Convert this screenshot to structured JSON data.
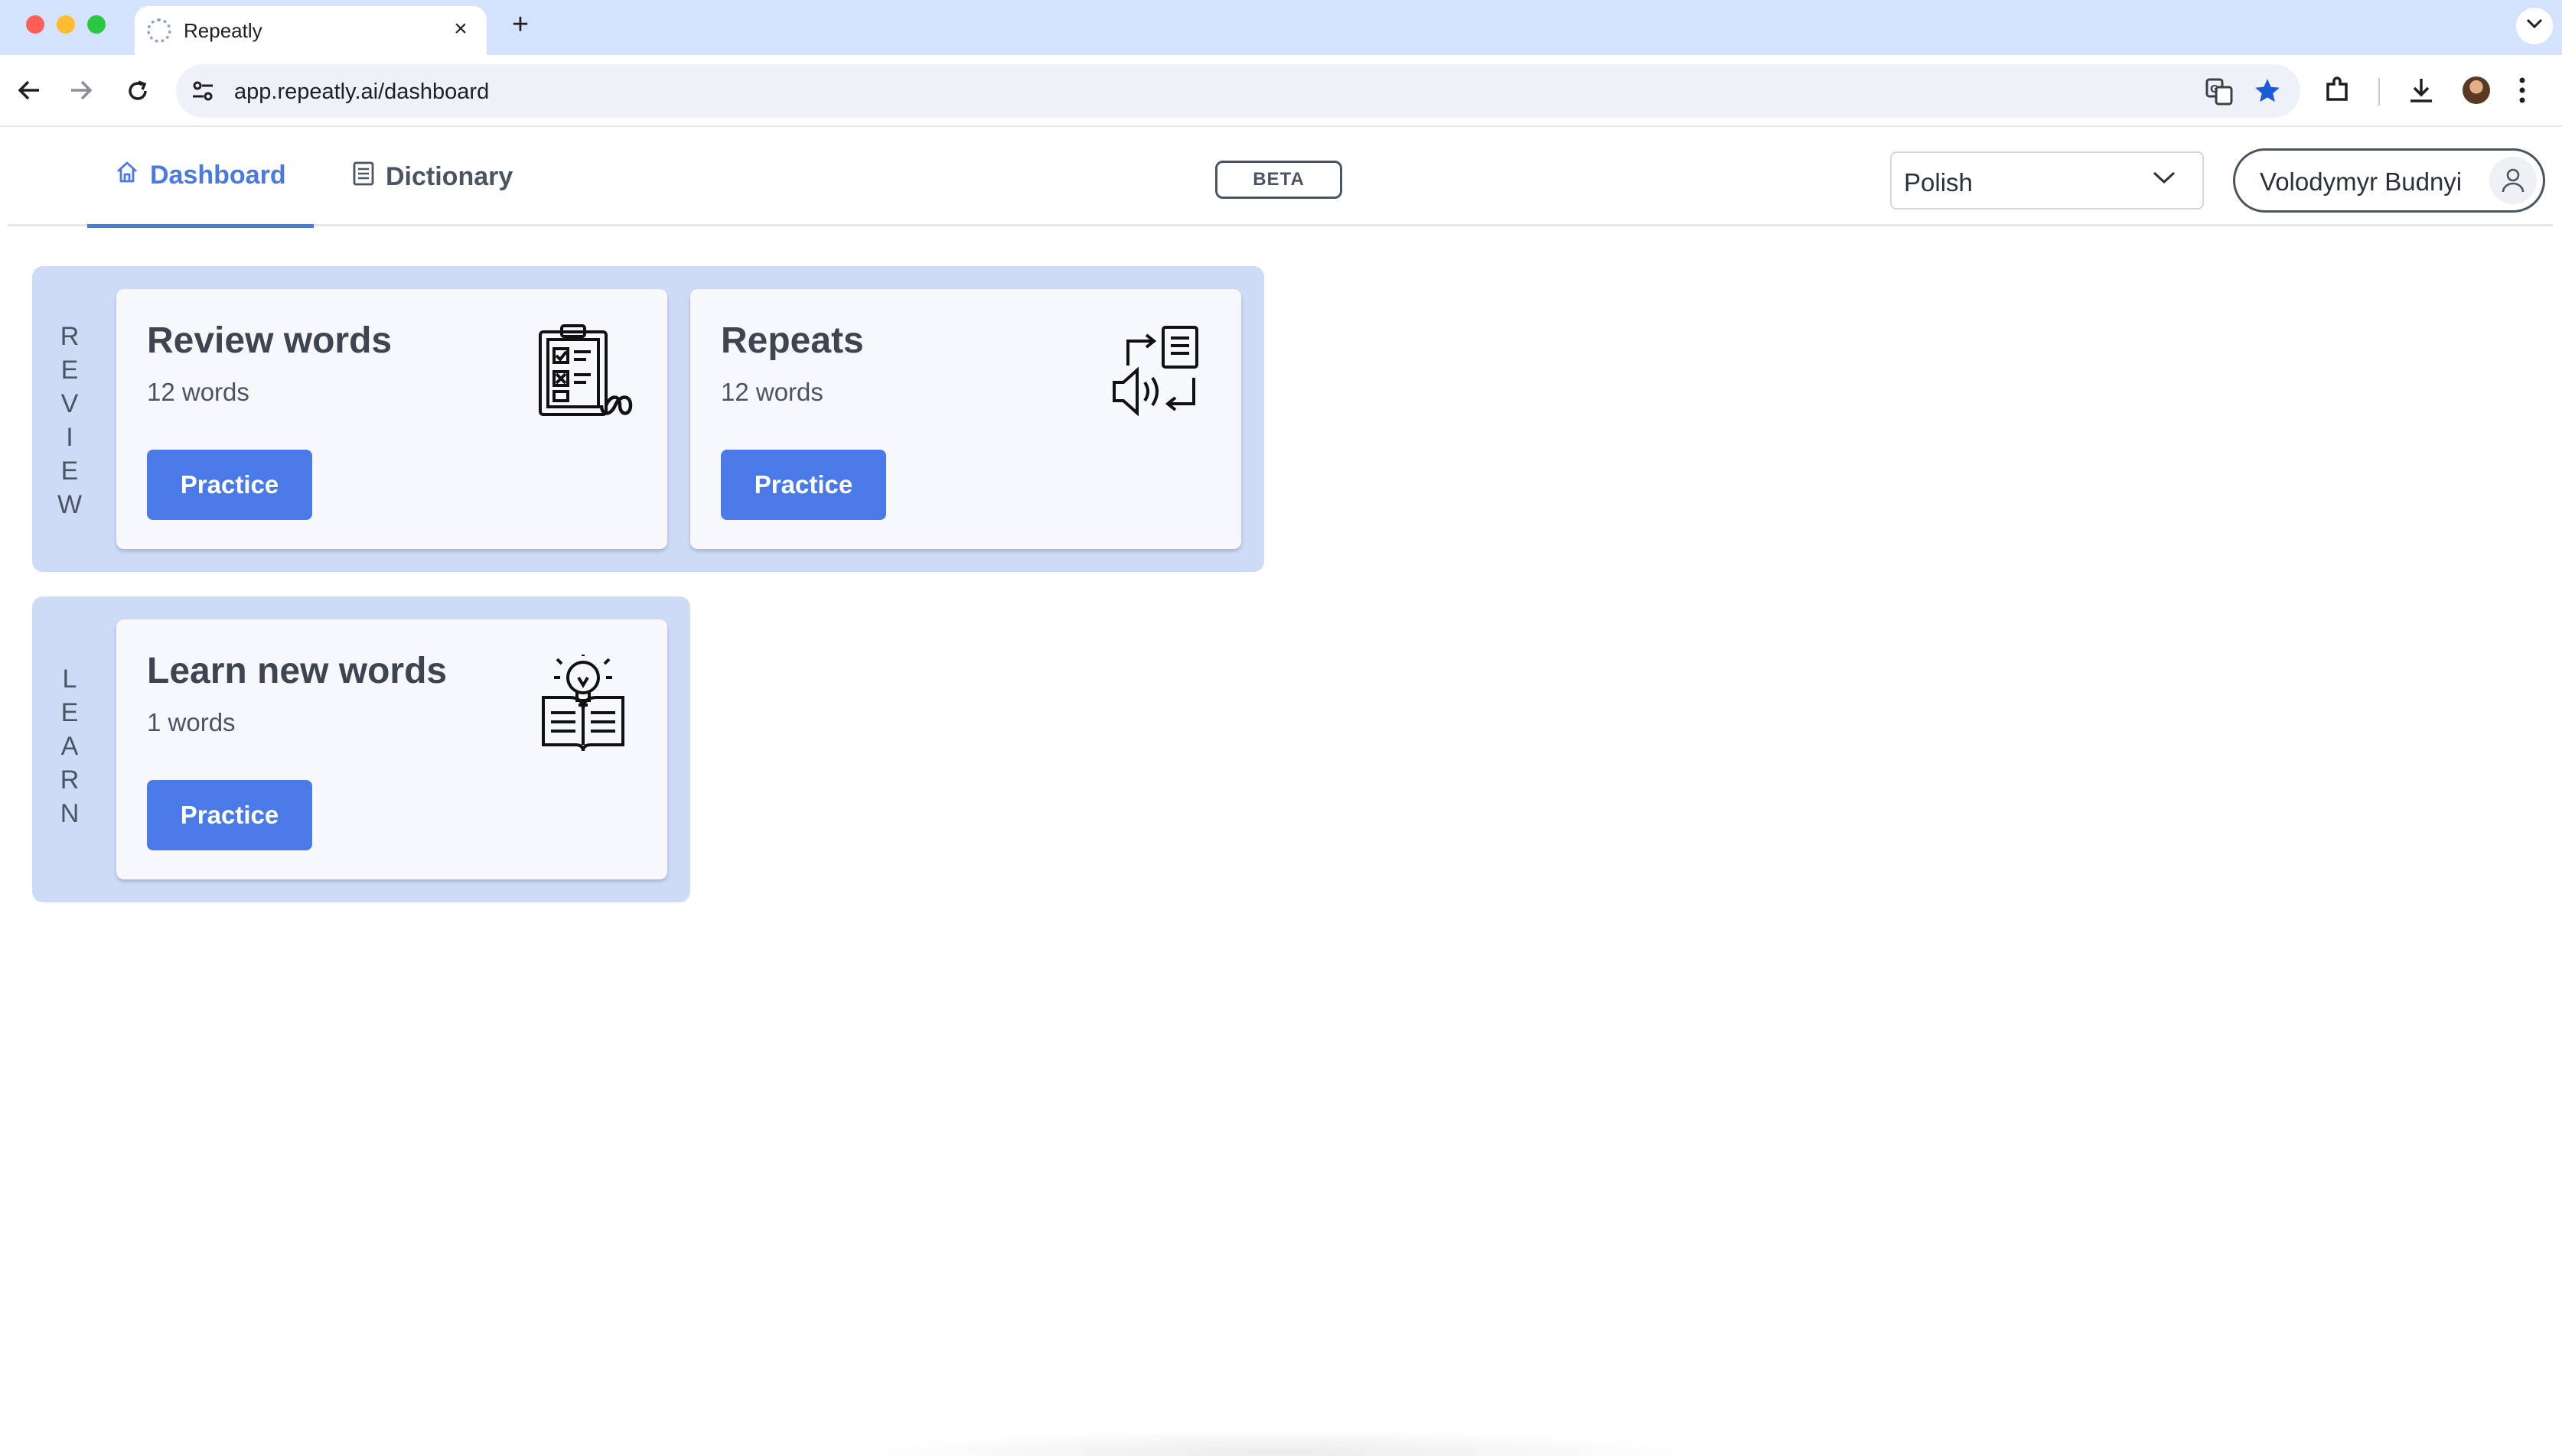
{
  "browser": {
    "tab_title": "Repeatly",
    "close_glyph": "×",
    "new_tab_glyph": "+",
    "url": "app.repeatly.ai/dashboard"
  },
  "header": {
    "nav": [
      {
        "label": "Dashboard",
        "icon": "home-icon",
        "active": true
      },
      {
        "label": "Dictionary",
        "icon": "list-icon",
        "active": false
      }
    ],
    "badge": "BETA",
    "language": "Polish",
    "user_name": "Volodymyr Budnyi"
  },
  "groups": {
    "review": {
      "label_letters": [
        "R",
        "E",
        "V",
        "I",
        "E",
        "W"
      ],
      "cards": [
        {
          "title": "Review words",
          "count": "12 words",
          "button": "Practice",
          "icon": "clipboard-checklist-icon"
        },
        {
          "title": "Repeats",
          "count": "12 words",
          "button": "Practice",
          "icon": "audio-repeat-icon"
        }
      ]
    },
    "learn": {
      "label_letters": [
        "L",
        "E",
        "A",
        "R",
        "N"
      ],
      "cards": [
        {
          "title": "Learn new words",
          "count": "1 words",
          "button": "Practice",
          "icon": "lightbulb-book-icon"
        }
      ]
    }
  },
  "colors": {
    "accent": "#4a7ae8",
    "group_bg": "#cddbf7",
    "card_bg": "#f6f8fc",
    "tabstrip_bg": "#d3e3fd"
  }
}
